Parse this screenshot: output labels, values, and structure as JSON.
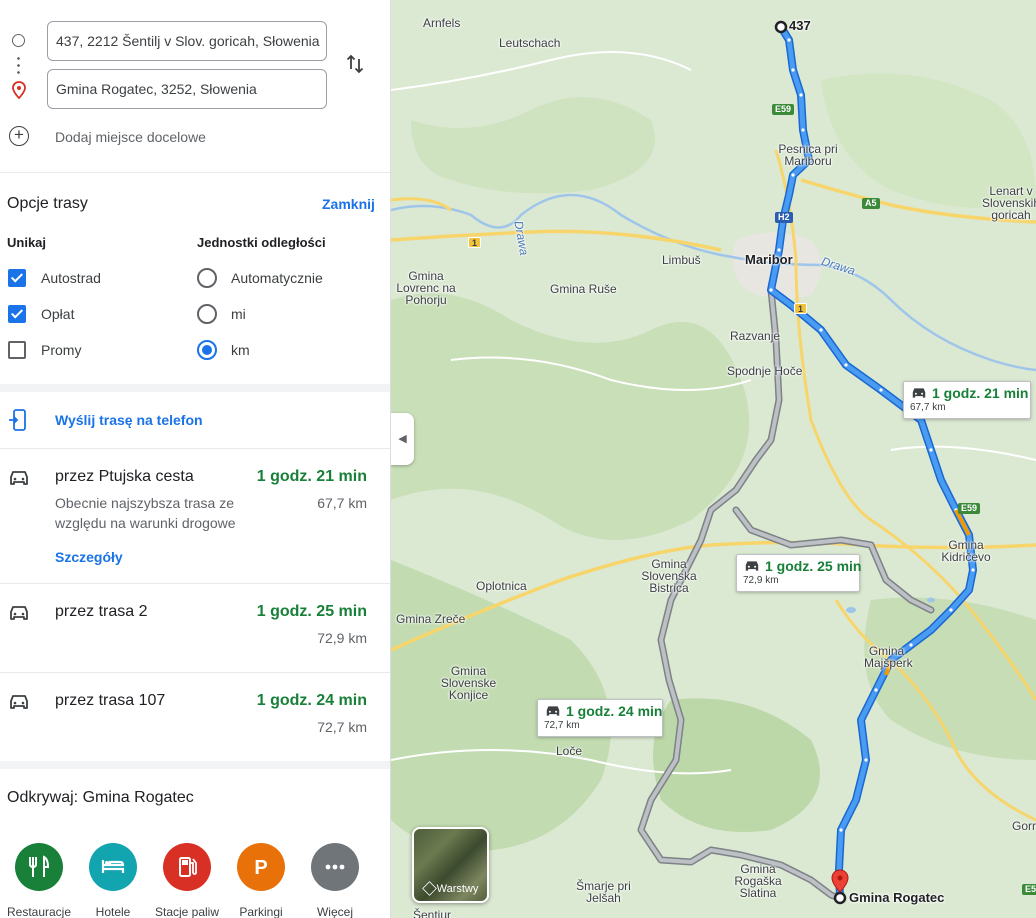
{
  "directions": {
    "origin": "437, 2212 Šentilj v Slov. goricah, Słowenia",
    "destination": "Gmina Rogatec, 3252, Słowenia",
    "add_destination": "Dodaj miejsce docelowe"
  },
  "route_options": {
    "title": "Opcje trasy",
    "close": "Zamknij",
    "avoid_heading": "Unikaj",
    "avoid": [
      {
        "label": "Autostrad",
        "checked": true
      },
      {
        "label": "Opłat",
        "checked": true
      },
      {
        "label": "Promy",
        "checked": false
      }
    ],
    "units_heading": "Jednostki odległości",
    "units": [
      {
        "label": "Automatycznie",
        "selected": false
      },
      {
        "label": "mi",
        "selected": false
      },
      {
        "label": "km",
        "selected": true
      }
    ]
  },
  "send_to_phone": "Wyślij trasę na telefon",
  "routes": [
    {
      "name": "przez Ptujska cesta",
      "time": "1 godz. 21 min",
      "distance": "67,7 km",
      "description": "Obecnie najszybsza trasa ze względu na warunki drogowe",
      "details": "Szczegóły"
    },
    {
      "name": "przez trasa 2",
      "time": "1 godz. 25 min",
      "distance": "72,9 km"
    },
    {
      "name": "przez trasa 107",
      "time": "1 godz. 24 min",
      "distance": "72,7 km"
    }
  ],
  "explore": {
    "title": "Odkrywaj: Gmina Rogatec",
    "categories": [
      {
        "label": "Restauracje",
        "icon": "restaurant-icon",
        "color": "#188038"
      },
      {
        "label": "Hotele",
        "icon": "hotel-icon",
        "color": "#12a4af"
      },
      {
        "label": "Stacje paliw",
        "icon": "gas-station-icon",
        "color": "#d93025"
      },
      {
        "label": "Parkingi",
        "icon": "parking-icon",
        "color": "#e8710a"
      },
      {
        "label": "Więcej",
        "icon": "more-icon",
        "color": "#70757a"
      }
    ]
  },
  "map": {
    "places": {
      "arnfels": "Arnfels",
      "leutschach": "Leutschach",
      "start_label": "437",
      "pesnica": "Pesnica pri Mariboru",
      "lenart": "Lenart v Slovenskih goricah",
      "gmina_lovrenc": "Gmina Lovrenc na Pohorju",
      "limbus": "Limbuš",
      "maribor": "Maribor",
      "drawa1": "Drawa",
      "drawa2": "Drawa",
      "gmina_ruse": "Gmina Ruše",
      "razvanje": "Razvanje",
      "spodnje_hoce": "Spodnje Hoče",
      "gmina_kidricevo": "Gmina Kidričevo",
      "gmina_slovenska_bistrica": "Gmina Slovenska Bistrica",
      "oplotnica": "Oplotnica",
      "gmina_zrece": "Gmina Zreče",
      "gmina_majsperk": "Gmina Majšperk",
      "gmina_slovenske_konjice": "Gmina Slovenske Konjice",
      "loce": "Loče",
      "gmina_rogaska_slatina": "Gmina Rogaška Slatina",
      "smarje": "Šmarje pri Jelšah",
      "sentjur": "Šentjur",
      "gorr": "Gorr",
      "end_label": "Gmina Rogatec"
    },
    "shields": {
      "e59a": "E59",
      "h2": "H2",
      "a5": "A5",
      "r1a": "1",
      "r1b": "1",
      "e59b": "E59",
      "e5": "E5"
    },
    "callouts": [
      {
        "time": "1 godz. 21 min",
        "distance": "67,7 km"
      },
      {
        "time": "1 godz. 25 min",
        "distance": "72,9 km"
      },
      {
        "time": "1 godz. 24 min",
        "distance": "72,7 km"
      }
    ],
    "layers_label": "Warstwy",
    "colors": {
      "route_primary": "#1a73e8",
      "route_alt": "#9aa0a6",
      "green_time": "#188038"
    }
  }
}
